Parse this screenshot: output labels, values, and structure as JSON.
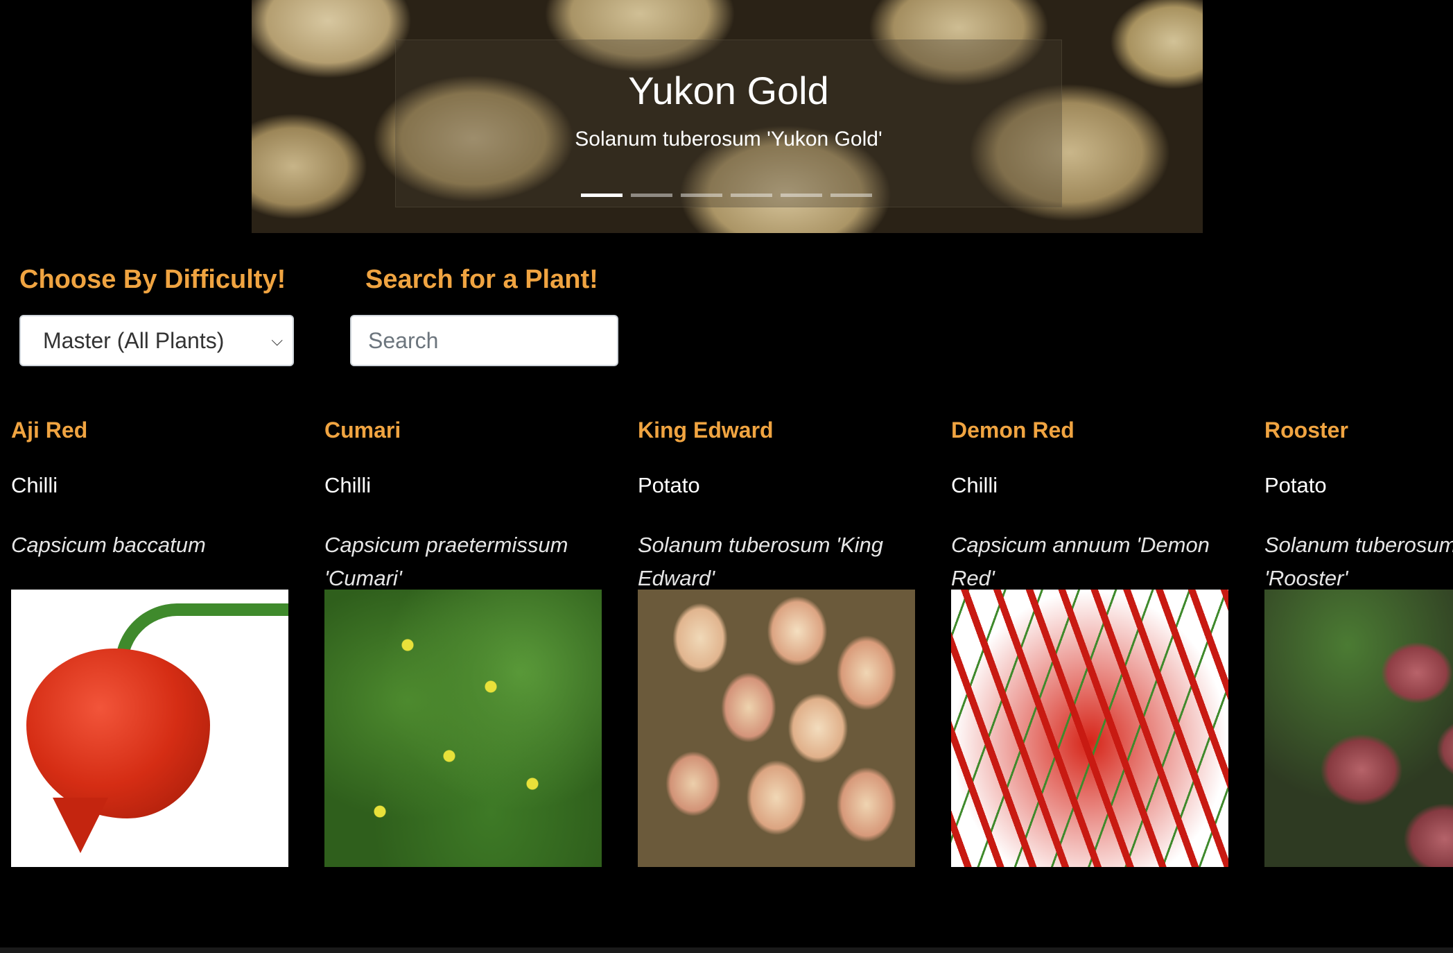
{
  "carousel": {
    "title": "Yukon Gold",
    "subtitle": "Solanum tuberosum 'Yukon Gold'",
    "slide_count": 6,
    "active_slide": 1
  },
  "filters": {
    "difficulty_heading": "Choose By Difficulty!",
    "difficulty_selected": "Master (All Plants)",
    "search_heading": "Search for a Plant!",
    "search_placeholder": "Search"
  },
  "plants": [
    {
      "name": "Aji Red",
      "type": "Chilli",
      "latin": "Capsicum baccatum"
    },
    {
      "name": "Cumari",
      "type": "Chilli",
      "latin": "Capsicum praetermissum 'Cumari'"
    },
    {
      "name": "King Edward",
      "type": "Potato",
      "latin": "Solanum tuberosum 'King Edward'"
    },
    {
      "name": "Demon Red",
      "type": "Chilli",
      "latin": "Capsicum annuum 'Demon Red'"
    },
    {
      "name": "Rooster",
      "type": "Potato",
      "latin": "Solanum tuberosum 'Rooster'"
    }
  ],
  "colors": {
    "accent": "#f0a441",
    "background": "#000000"
  }
}
